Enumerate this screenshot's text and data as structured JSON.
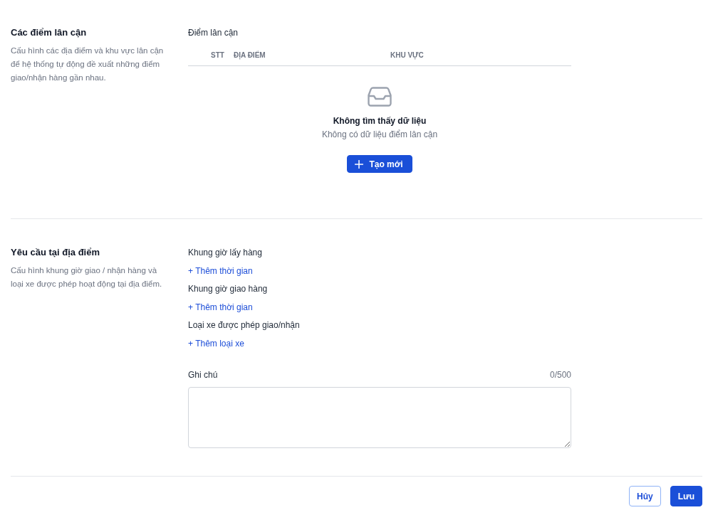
{
  "nearby_section": {
    "title": "Các điểm lân cận",
    "description": "Cấu hình các địa điểm và khu vực lân cận để hệ thống tự động đề xuất những điểm giao/nhận hàng gần nhau.",
    "table": {
      "label": "Điểm lân cận",
      "columns": [
        "STT",
        "ĐỊA ĐIỂM",
        "KHU VỰC"
      ],
      "empty_state": {
        "title": "Không tìm thấy dữ liệu",
        "message": "Không có dữ liệu điểm lân cận",
        "button": "Tạo mới"
      }
    }
  },
  "requirements_section": {
    "title": "Yêu cầu tại địa điểm",
    "description": "Cấu hình khung giờ giao / nhận hàng và loại xe được phép hoạt động tại địa điểm.",
    "groups": [
      {
        "label": "Khung giờ lấy hàng",
        "link": "+ Thêm thời gian"
      },
      {
        "label": "Khung giờ giao hàng",
        "link": "+ Thêm thời gian"
      },
      {
        "label": "Loại xe được phép giao/nhận",
        "link": "+ Thêm loại xe"
      }
    ],
    "note": {
      "label": "Ghi chú",
      "counter": "0/500"
    }
  },
  "footer": {
    "buttons": [
      {
        "label": "Hủy",
        "kind": "secondary"
      },
      {
        "label": "Lưu",
        "kind": "primary"
      }
    ]
  }
}
